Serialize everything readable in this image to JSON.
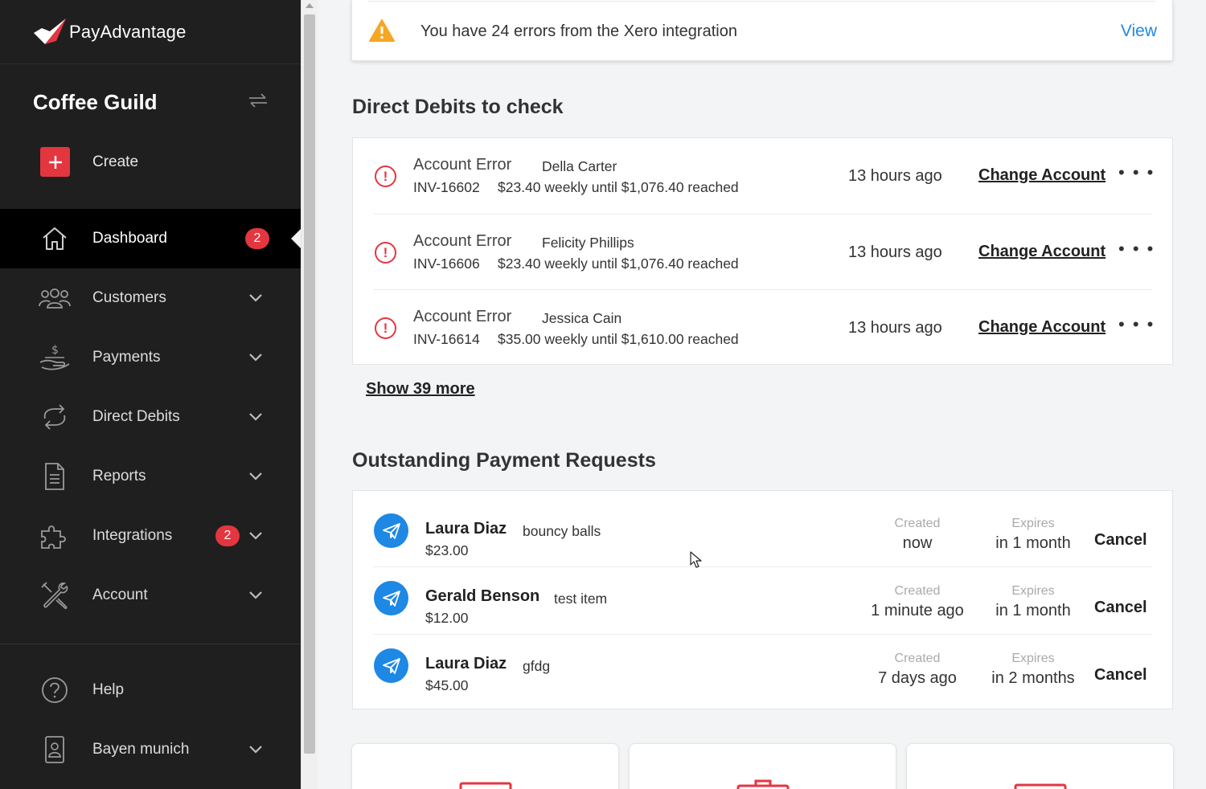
{
  "brand": {
    "name": "PayAdvantage"
  },
  "sidebar": {
    "org_name": "Coffee Guild",
    "create_label": "Create",
    "items": [
      {
        "label": "Dashboard",
        "icon": "home-icon",
        "badge": "2",
        "active": true
      },
      {
        "label": "Customers",
        "icon": "users-icon"
      },
      {
        "label": "Payments",
        "icon": "payments-icon"
      },
      {
        "label": "Direct Debits",
        "icon": "repeat-icon"
      },
      {
        "label": "Reports",
        "icon": "document-icon"
      },
      {
        "label": "Integrations",
        "icon": "puzzle-icon",
        "badge": "2"
      },
      {
        "label": "Account",
        "icon": "tools-icon"
      }
    ],
    "bottom_items": [
      {
        "label": "Help",
        "icon": "help-icon"
      },
      {
        "label": "Bayen munich",
        "icon": "user-badge-icon"
      }
    ]
  },
  "alert": {
    "text": "You have 24 errors from the Xero integration",
    "action": "View"
  },
  "direct_debits": {
    "title": "Direct Debits to check",
    "rows": [
      {
        "type": "Account Error",
        "name": "Della Carter",
        "invoice": "INV-16602",
        "amount": "$23.40 weekly until $1,076.40 reached",
        "time": "13 hours ago",
        "action": "Change Account",
        "more": "• • •"
      },
      {
        "type": "Account Error",
        "name": "Felicity Phillips",
        "invoice": "INV-16606",
        "amount": "$23.40 weekly until $1,076.40 reached",
        "time": "13 hours ago",
        "action": "Change Account",
        "more": "• • •"
      },
      {
        "type": "Account Error",
        "name": "Jessica Cain",
        "invoice": "INV-16614",
        "amount": "$35.00 weekly until $1,610.00 reached",
        "time": "13 hours ago",
        "action": "Change Account",
        "more": "• • •"
      }
    ],
    "show_more": "Show 39 more"
  },
  "payment_requests": {
    "title": "Outstanding Payment Requests",
    "created_label": "Created",
    "expires_label": "Expires",
    "rows": [
      {
        "name": "Laura Diaz",
        "item": "bouncy balls",
        "amount": "$23.00",
        "created": "now",
        "expires": "in 1 month",
        "action": "Cancel"
      },
      {
        "name": "Gerald Benson",
        "item": "test item",
        "amount": "$12.00",
        "created": "1 minute ago",
        "expires": "in 1 month",
        "action": "Cancel"
      },
      {
        "name": "Laura Diaz",
        "item": "gfdg",
        "amount": "$45.00",
        "created": "7 days ago",
        "expires": "in 2 months",
        "action": "Cancel"
      }
    ]
  },
  "colors": {
    "accent_red": "#e4363f",
    "accent_blue": "#1e88e5",
    "sidebar_bg": "#1f1f1f",
    "warning": "#f5a623"
  }
}
